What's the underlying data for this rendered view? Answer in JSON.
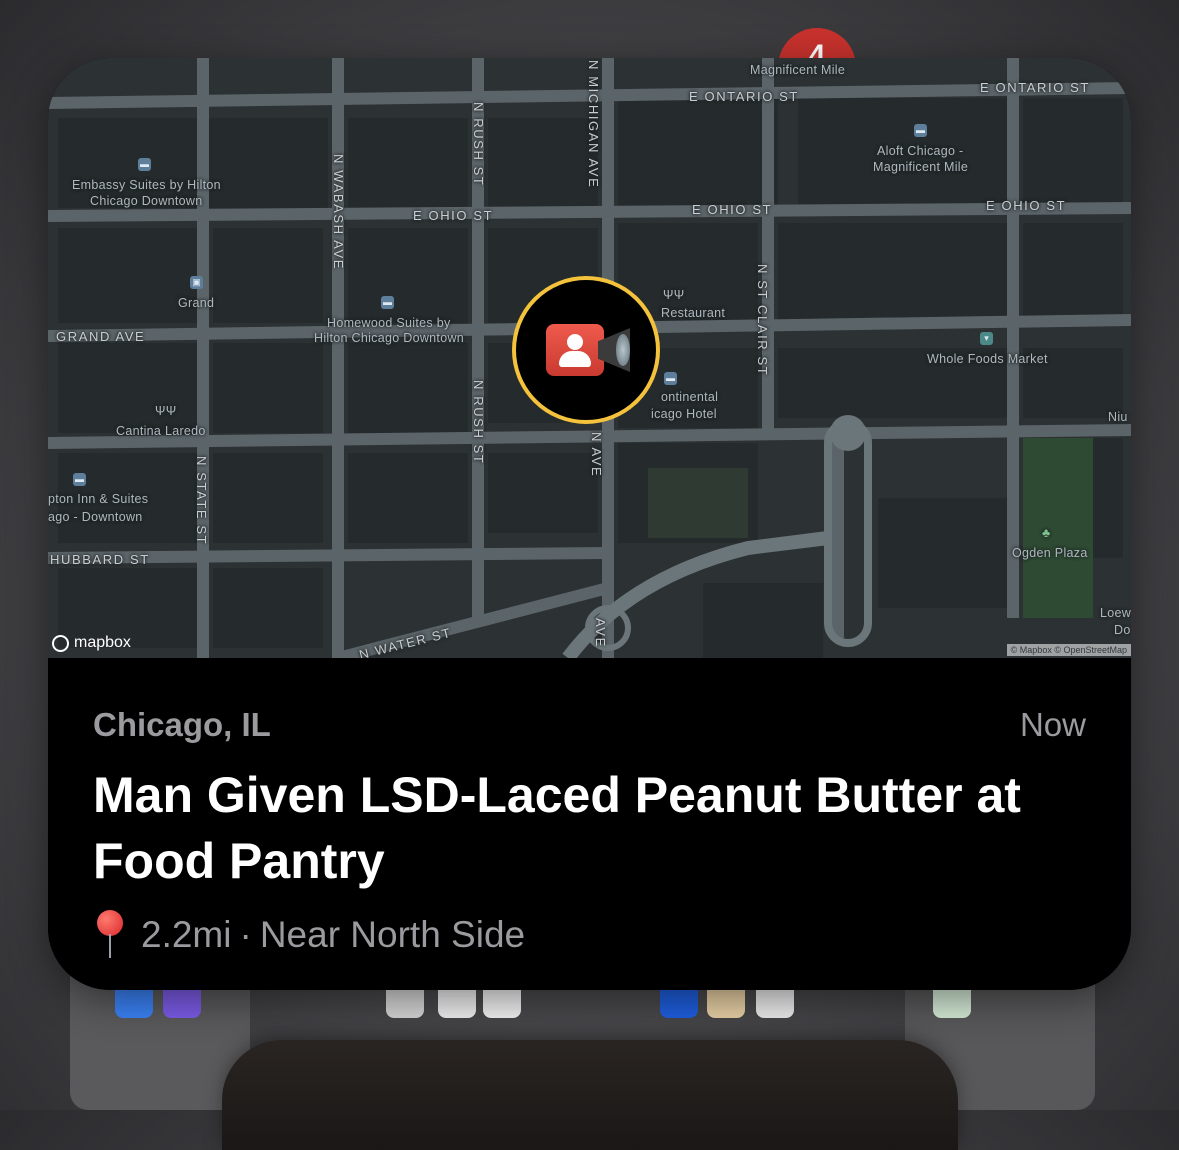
{
  "notification": {
    "location": "Chicago, IL",
    "time": "Now",
    "title": "Man Given LSD-Laced Peanut Butter at Food Pantry",
    "distance": "2.2mi",
    "separator": "·",
    "neighborhood": "Near North Side",
    "badge": "4"
  },
  "map": {
    "attribution": "© Mapbox © OpenStreetMap",
    "logo": "mapbox",
    "streets": {
      "e_ontario_1": "E ONTARIO ST",
      "e_ontario_2": "E ONTARIO ST",
      "e_ohio_1": "E OHIO ST",
      "e_ohio_2": "E OHIO ST",
      "e_ohio_3": "E OHIO ST",
      "grand_ave": "GRAND AVE",
      "hubbard_st": "HUBBARD ST",
      "n_water_st": "N WATER ST",
      "n_wabash_ave": "N WABASH AVE",
      "n_rush_st_1": "N RUSH ST",
      "n_rush_st_2": "N RUSH ST",
      "n_michigan_ave": "N MICHIGAN AVE",
      "n_ave": "N AVE",
      "ave": "AVE",
      "n_st_clair_st": "N ST CLAIR ST",
      "n_state_st": "N STATE ST"
    },
    "pois": {
      "magnificent_mile": "Magnificent Mile",
      "embassy_1": "Embassy Suites by Hilton",
      "embassy_2": "Chicago Downtown",
      "aloft_1": "Aloft Chicago -",
      "aloft_2": "Magnificent Mile",
      "grand": "Grand",
      "homewood_1": "Homewood Suites by",
      "homewood_2": "Hilton Chicago Downtown",
      "restaurant": "Restaurant",
      "whole_foods": "Whole Foods Market",
      "continental_1": "ontinental",
      "continental_2": "icago Hotel",
      "cantina": "Cantina Laredo",
      "hampton_1": "pton Inn & Suites",
      "hampton_2": "ago - Downtown",
      "ogden": "Ogden Plaza",
      "niu": "Niu",
      "loews_1": "Loew",
      "loews_2": "Do"
    }
  },
  "colors": {
    "map_bg": "#2c3133",
    "road": "#5b6469",
    "pin_ring": "#f5c33b",
    "camera": "#e34a3e",
    "secondary_text": "#9a9a9f"
  },
  "icons": [
    "camera-alert-icon",
    "pushpin-icon",
    "hotel-icon",
    "restaurant-icon",
    "grocery-icon",
    "park-icon"
  ]
}
